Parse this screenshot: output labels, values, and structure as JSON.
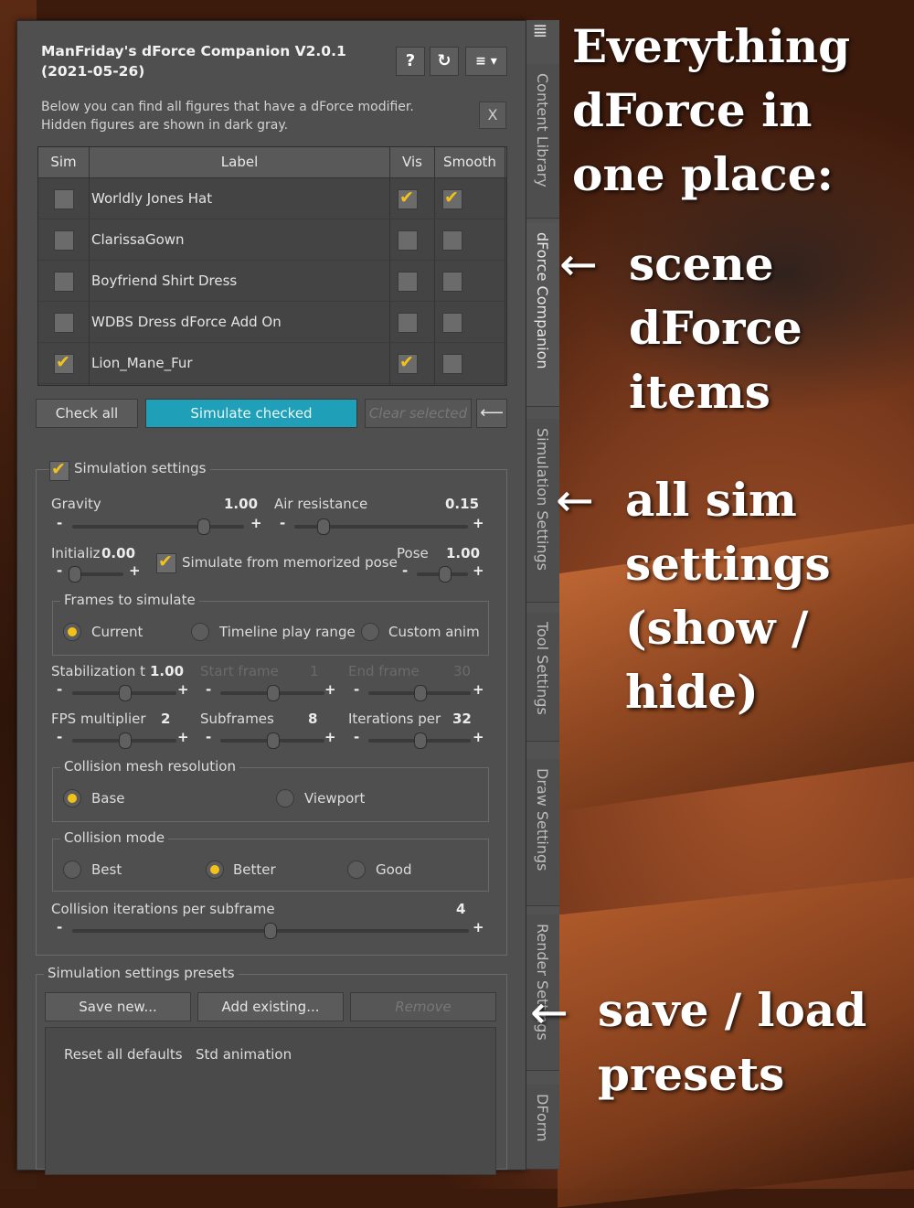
{
  "window": {
    "title_line1": "ManFriday's dForce Companion V2.0.1",
    "title_line2": "(2021-05-26)",
    "help_label": "?",
    "refresh_label": "↻",
    "menu_label": "≡ ▾",
    "description_line1": "Below you can find all figures that have a dForce modifier.",
    "description_line2": "Hidden figures are shown in dark gray.",
    "close_label": "X"
  },
  "table": {
    "headers": [
      "Sim",
      "Label",
      "Vis",
      "Smooth"
    ],
    "rows": [
      {
        "label": "Worldly Jones Hat",
        "sim": false,
        "vis": true,
        "smooth": true
      },
      {
        "label": "ClarissaGown",
        "sim": false,
        "vis": false,
        "smooth": false
      },
      {
        "label": "Boyfriend Shirt Dress",
        "sim": false,
        "vis": false,
        "smooth": false
      },
      {
        "label": "WDBS Dress dForce Add On",
        "sim": false,
        "vis": false,
        "smooth": false
      },
      {
        "label": "Lion_Mane_Fur",
        "sim": true,
        "vis": true,
        "smooth": false
      }
    ]
  },
  "actions": {
    "check_all": "Check all",
    "simulate_checked": "Simulate checked",
    "clear_selected": "Clear selected",
    "back_arrow": "⟵"
  },
  "sim_settings": {
    "group_label": "Simulation settings",
    "enabled": true,
    "gravity_label": "Gravity",
    "gravity_value": "1.00",
    "air_label": "Air resistance",
    "air_value": "0.15",
    "init_label": "Initializ",
    "init_value": "0.00",
    "memorized_label": "Simulate from memorized pose",
    "memorized_checked": true,
    "pose_label": "Pose",
    "pose_value": "1.00",
    "frames_group": "Frames to simulate",
    "frames_options": [
      "Current",
      "Timeline play range",
      "Custom anim"
    ],
    "frames_selected": 0,
    "stab_label": "Stabilization t",
    "stab_value": "1.00",
    "start_label": "Start frame",
    "start_value": "1",
    "end_label": "End frame",
    "end_value": "30",
    "fps_label": "FPS multiplier",
    "fps_value": "2",
    "subframes_label": "Subframes",
    "subframes_value": "8",
    "iter_label": "Iterations per",
    "iter_value": "32",
    "mesh_group": "Collision mesh resolution",
    "mesh_options": [
      "Base",
      "Viewport"
    ],
    "mesh_selected": 0,
    "mode_group": "Collision mode",
    "mode_options": [
      "Best",
      "Better",
      "Good"
    ],
    "mode_selected": 1,
    "coll_iter_label": "Collision iterations per subframe",
    "coll_iter_value": "4",
    "minus": "-",
    "plus": "+"
  },
  "presets": {
    "group_label": "Simulation settings presets",
    "save_new": "Save new...",
    "add_existing": "Add existing...",
    "remove": "Remove",
    "items": [
      "Reset all defaults",
      "Std animation"
    ]
  },
  "side_tabs": [
    "Content Library",
    "dForce Companion",
    "Simulation Settings",
    "Tool Settings",
    "Draw Settings",
    "Render Settings",
    "DForm"
  ],
  "side_menu_icon": "≣",
  "annotations": {
    "headline": [
      "Everything",
      "dForce in",
      "one place:"
    ],
    "scene": [
      "scene",
      "dForce",
      "items"
    ],
    "sim": [
      "all sim",
      "settings",
      "(show /",
      "hide)"
    ],
    "presets": [
      "save / load",
      "presets"
    ],
    "arrow": "←"
  }
}
